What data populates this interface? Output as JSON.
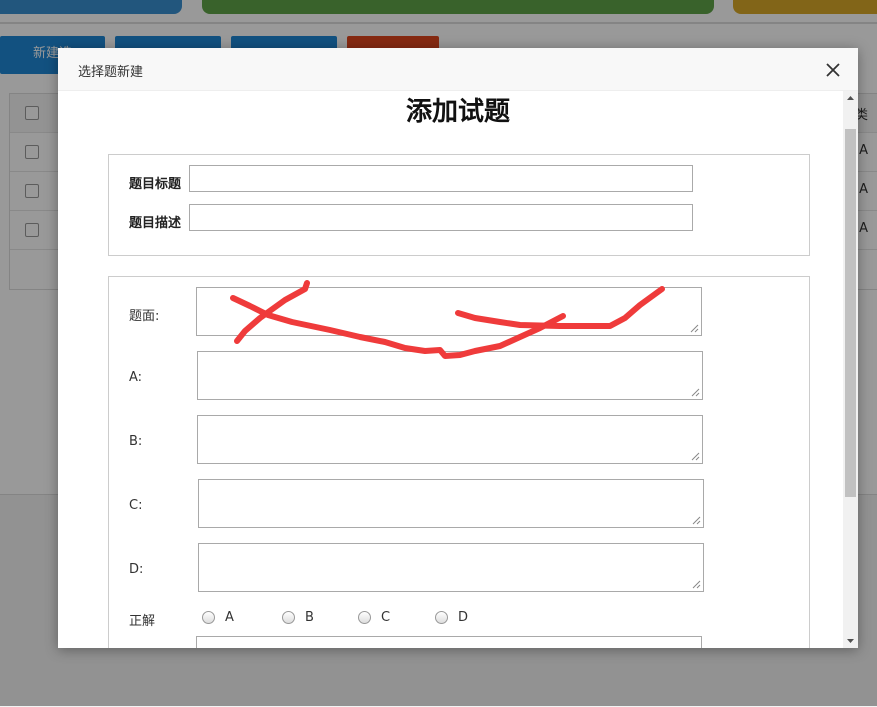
{
  "background": {
    "toolbar": {
      "new_button_label": "新建选",
      "other_buttons": [
        "",
        "",
        ""
      ]
    },
    "table_right_cells": [
      "A",
      "A",
      "A"
    ],
    "header_right_text": "类"
  },
  "modal": {
    "title": "选择题新建",
    "heading": "添加试题",
    "meta": {
      "title_label": "题目标题",
      "title_value": "",
      "desc_label": "题目描述",
      "desc_value": ""
    },
    "question": {
      "stem_label": "题面:",
      "options": [
        {
          "label": "A:",
          "value": ""
        },
        {
          "label": "B:",
          "value": ""
        },
        {
          "label": "C:",
          "value": ""
        },
        {
          "label": "D:",
          "value": ""
        }
      ],
      "answer_label": "正解",
      "answer_choices": [
        "A",
        "B",
        "C",
        "D"
      ]
    }
  },
  "colors": {
    "primary_button": "#1e88d6",
    "danger_button": "#e0461e",
    "annotation_stroke": "#ef3b3b"
  },
  "icons": {
    "close": "close-icon",
    "scroll_up": "scroll-up-icon",
    "scroll_down": "scroll-down-icon",
    "resize": "resize-grip-icon"
  }
}
